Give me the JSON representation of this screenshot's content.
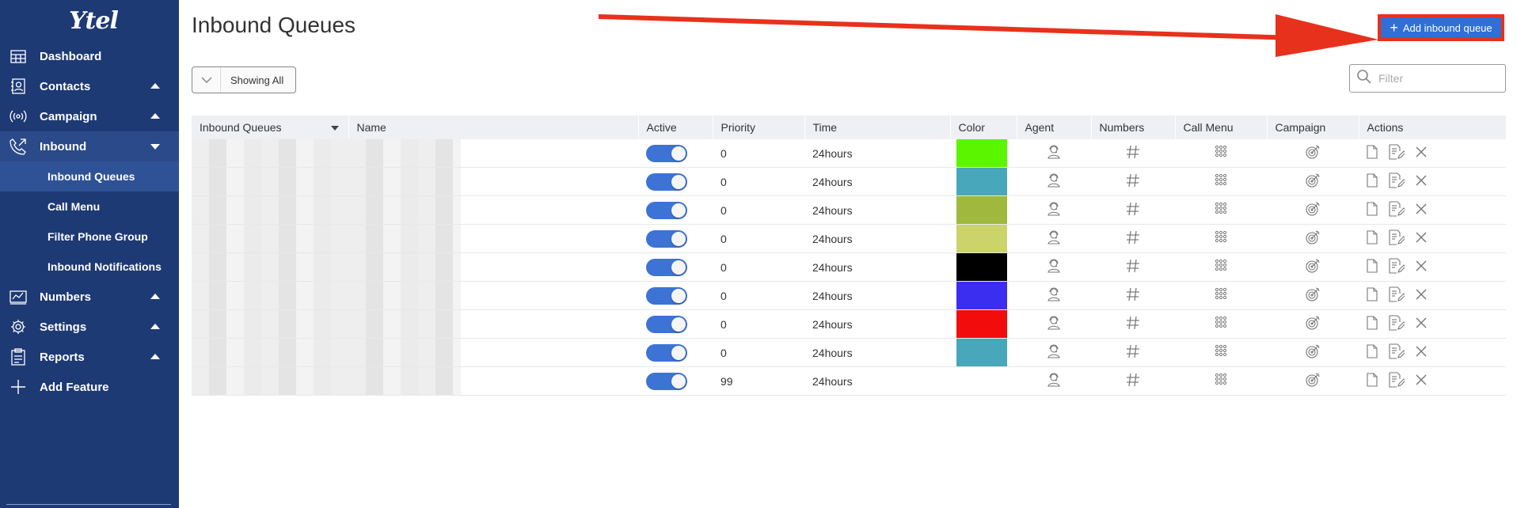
{
  "brand": {
    "logo_text": "Ytel"
  },
  "sidebar": {
    "items": [
      {
        "label": "Dashboard",
        "icon": "dashboard-icon",
        "caret": ""
      },
      {
        "label": "Contacts",
        "icon": "contacts-icon",
        "caret": "up"
      },
      {
        "label": "Campaign",
        "icon": "broadcast-icon",
        "caret": "up"
      },
      {
        "label": "Inbound",
        "icon": "phone-icon",
        "caret": "down"
      }
    ],
    "inbound_sub": [
      {
        "label": "Inbound Queues",
        "active": true
      },
      {
        "label": "Call Menu"
      },
      {
        "label": "Filter Phone Group"
      },
      {
        "label": "Inbound Notifications"
      }
    ],
    "items_after": [
      {
        "label": "Numbers",
        "icon": "numbers-icon",
        "caret": "up"
      },
      {
        "label": "Settings",
        "icon": "gear-icon",
        "caret": "up"
      },
      {
        "label": "Reports",
        "icon": "clipboard-icon",
        "caret": "up"
      },
      {
        "label": "Add Feature",
        "icon": "plus-icon",
        "caret": ""
      }
    ]
  },
  "header": {
    "title": "Inbound Queues",
    "add_button_label": "Add inbound queue"
  },
  "toolbar": {
    "showing_label": "Showing All",
    "filter_placeholder": "Filter"
  },
  "table": {
    "columns": [
      "Inbound Queues",
      "Name",
      "Active",
      "Priority",
      "Time",
      "Color",
      "Agent",
      "Numbers",
      "Call Menu",
      "Campaign",
      "Actions"
    ],
    "rows": [
      {
        "priority": "0",
        "time": "24hours",
        "color": "#5cf500",
        "active": true
      },
      {
        "priority": "0",
        "time": "24hours",
        "color": "#49a7bb",
        "active": true
      },
      {
        "priority": "0",
        "time": "24hours",
        "color": "#9fb83d",
        "active": true
      },
      {
        "priority": "0",
        "time": "24hours",
        "color": "#cbd36a",
        "active": true
      },
      {
        "priority": "0",
        "time": "24hours",
        "color": "#000000",
        "active": true
      },
      {
        "priority": "0",
        "time": "24hours",
        "color": "#3b2ef0",
        "active": true
      },
      {
        "priority": "0",
        "time": "24hours",
        "color": "#f20c0c",
        "active": true
      },
      {
        "priority": "0",
        "time": "24hours",
        "color": "#49a7bb",
        "active": true
      },
      {
        "priority": "99",
        "time": "24hours",
        "color": "",
        "active": true
      }
    ]
  },
  "colors": {
    "sidebar_bg": "#1e3a74",
    "accent": "#2f6fd6",
    "annotation_arrow": "#e8311c"
  }
}
